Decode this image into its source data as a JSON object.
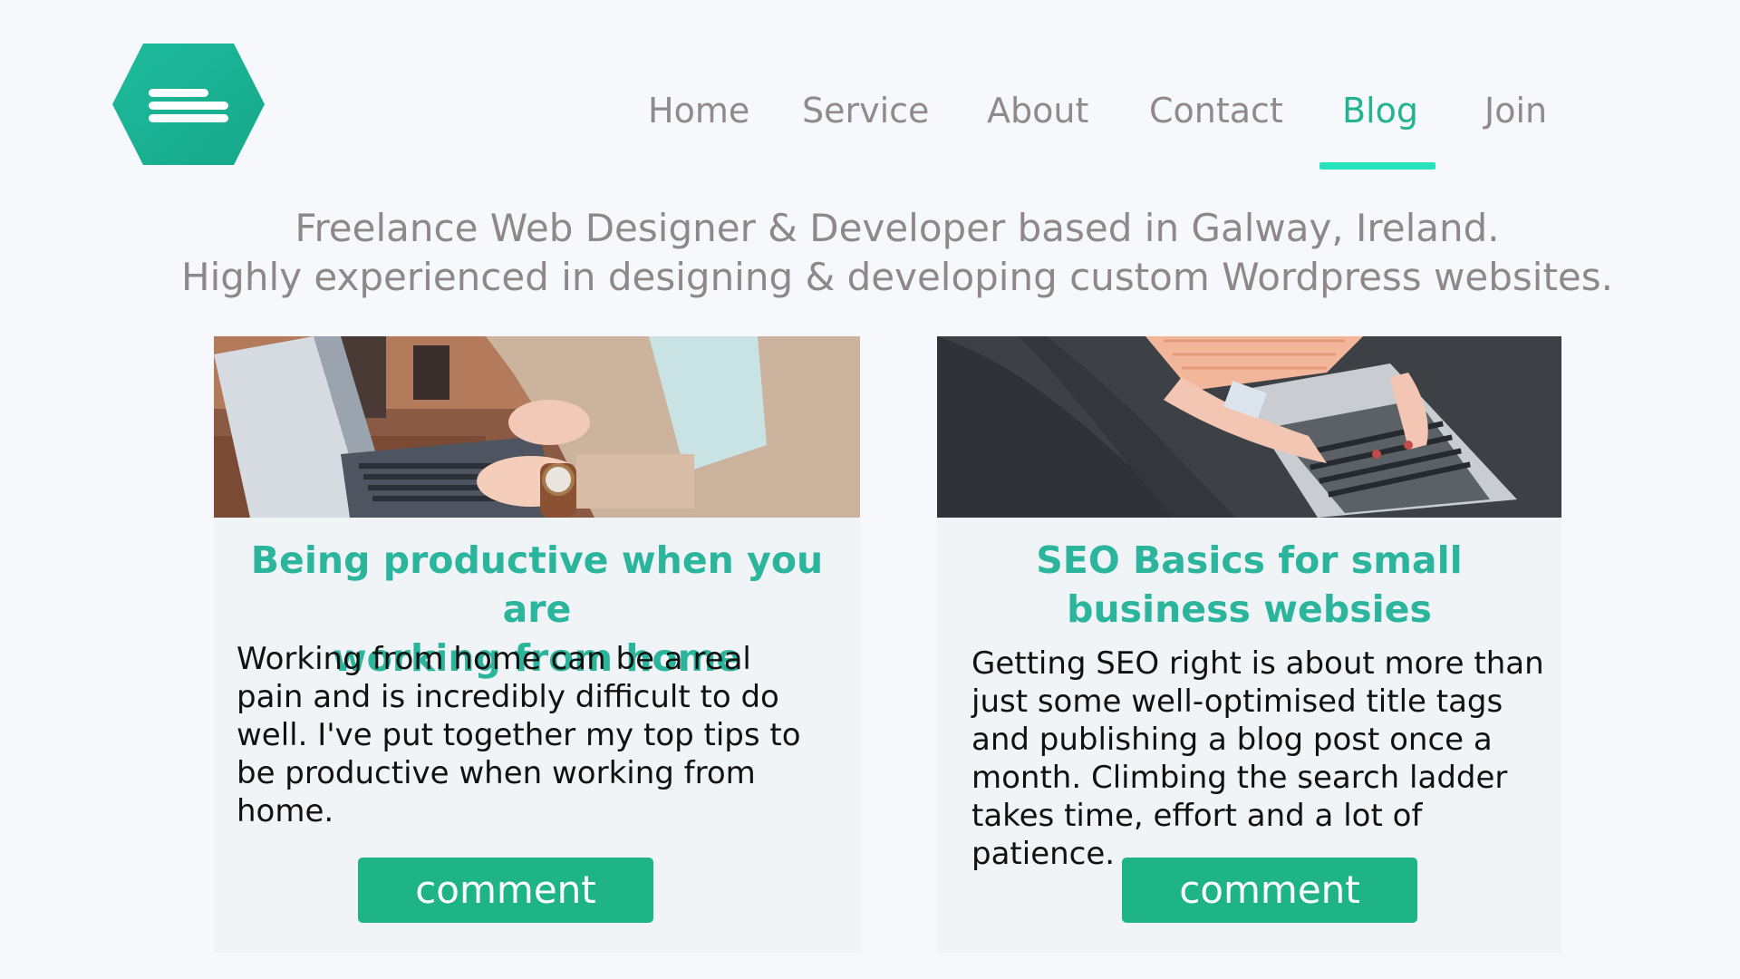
{
  "logo": {
    "icon": "menu-hexagon-icon",
    "color": "#1fb496"
  },
  "nav": {
    "items": [
      {
        "label": "Home"
      },
      {
        "label": "Service"
      },
      {
        "label": "About"
      },
      {
        "label": "Contact"
      },
      {
        "label": "Blog",
        "active": true
      },
      {
        "label": "Join"
      }
    ],
    "active_color": "#24b392",
    "underline_color": "#27e3bd"
  },
  "tagline": {
    "line1": "Freelance Web Designer & Developer based in Galway, Ireland.",
    "line2": "Highly experienced in designing & developing custom Wordpress websites."
  },
  "posts": [
    {
      "image": "laptop-typing-photo",
      "title_line1": "Being productive when you are",
      "title_line2": "working from home",
      "excerpt": "Working from home can be a real pain and is incredibly difficult to do well. I've put together my top tips to be productive when working from home.",
      "button": "comment"
    },
    {
      "image": "laptop-on-lap-photo",
      "title_line1": "SEO Basics for small",
      "title_line2": "business websies",
      "excerpt": "Getting SEO right is about more than just some well-optimised title tags and publishing a blog post once a month. Climbing the search ladder takes time, effort and a lot of patience.",
      "button": "comment"
    }
  ],
  "colors": {
    "background": "#f7f8fb",
    "card": "#f1f4f7",
    "title": "#2bb59c",
    "button": "#1fb484",
    "muted_text": "#8d8889"
  }
}
